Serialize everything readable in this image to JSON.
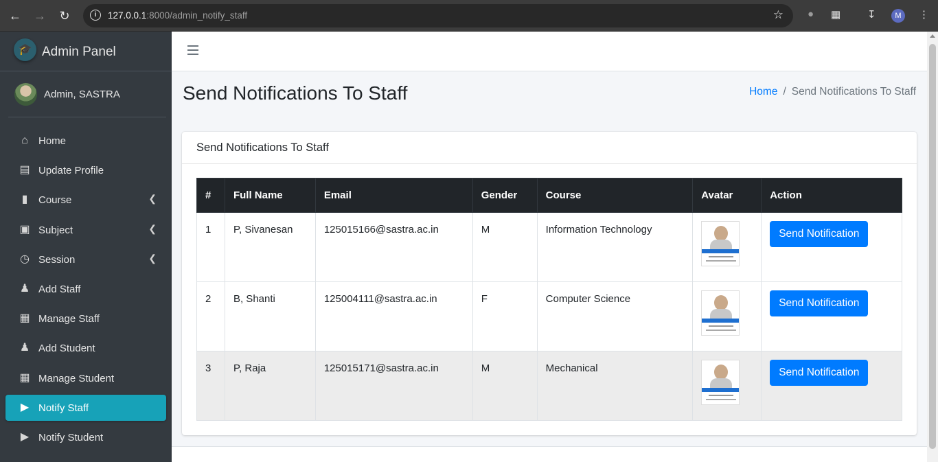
{
  "browser": {
    "url_host": "127.0.0.1",
    "url_path": ":8000/admin_notify_staff",
    "profile_initial": "M"
  },
  "sidebar": {
    "brand": "Admin Panel",
    "user_name": "Admin, SASTRA",
    "items": [
      {
        "label": "Home",
        "icon": "home-icon",
        "active": false,
        "has_arrow": false
      },
      {
        "label": "Update Profile",
        "icon": "id-card-icon",
        "active": false,
        "has_arrow": false
      },
      {
        "label": "Course",
        "icon": "bookmark-icon",
        "active": false,
        "has_arrow": true
      },
      {
        "label": "Subject",
        "icon": "book-icon",
        "active": false,
        "has_arrow": true
      },
      {
        "label": "Session",
        "icon": "clock-icon",
        "active": false,
        "has_arrow": true
      },
      {
        "label": "Add Staff",
        "icon": "user-plus-icon",
        "active": false,
        "has_arrow": false
      },
      {
        "label": "Manage Staff",
        "icon": "grid-icon",
        "active": false,
        "has_arrow": false
      },
      {
        "label": "Add Student",
        "icon": "user-plus-icon",
        "active": false,
        "has_arrow": false
      },
      {
        "label": "Manage Student",
        "icon": "grid-icon",
        "active": false,
        "has_arrow": false
      },
      {
        "label": "Notify Staff",
        "icon": "bullhorn-icon",
        "active": true,
        "has_arrow": false
      },
      {
        "label": "Notify Student",
        "icon": "bullhorn-icon",
        "active": false,
        "has_arrow": false
      }
    ]
  },
  "page": {
    "title": "Send Notifications To Staff",
    "breadcrumb_home": "Home",
    "breadcrumb_sep": "/",
    "breadcrumb_current": "Send Notifications To Staff"
  },
  "card": {
    "title": "Send Notifications To Staff",
    "columns": [
      "#",
      "Full Name",
      "Email",
      "Gender",
      "Course",
      "Avatar",
      "Action"
    ],
    "rows": [
      {
        "num": "1",
        "name": "P, Sivanesan",
        "email": "125015166@sastra.ac.in",
        "gender": "M",
        "course": "Information Technology",
        "action": "Send Notification"
      },
      {
        "num": "2",
        "name": "B, Shanti",
        "email": "125004111@sastra.ac.in",
        "gender": "F",
        "course": "Computer Science",
        "action": "Send Notification"
      },
      {
        "num": "3",
        "name": "P, Raja",
        "email": "125015171@sastra.ac.in",
        "gender": "M",
        "course": "Mechanical",
        "action": "Send Notification"
      }
    ]
  },
  "colors": {
    "sidebar_bg": "#343a40",
    "active_item": "#17a2b8",
    "primary_button": "#007bff",
    "table_header": "#212529"
  }
}
